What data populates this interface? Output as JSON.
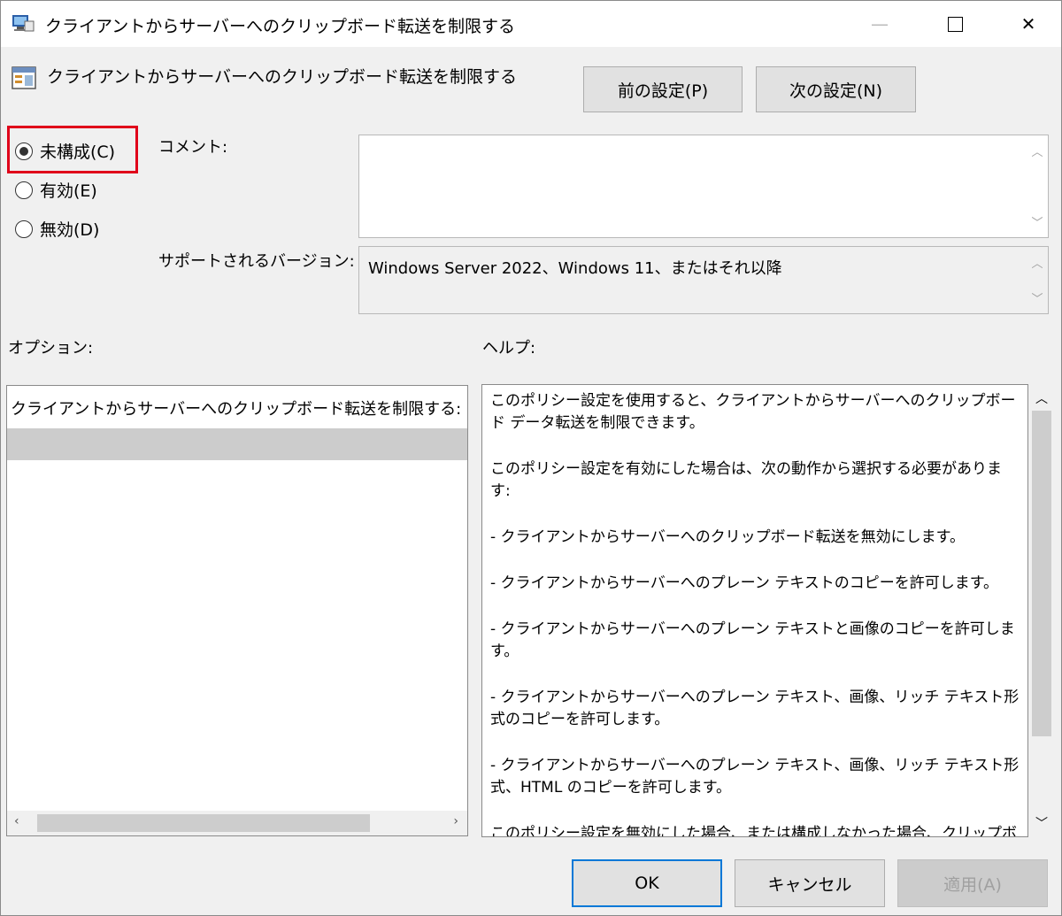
{
  "window": {
    "title": "クライアントからサーバーへのクリップボード転送を制限する",
    "minimize_label": "—",
    "close_label": "✕"
  },
  "heading": {
    "title": "クライアントからサーバーへのクリップボード転送を制限する"
  },
  "nav": {
    "prev_label": "前の設定(P)",
    "next_label": "次の設定(N)"
  },
  "state": {
    "options": [
      {
        "label": "未構成(C)",
        "selected": true
      },
      {
        "label": "有効(E)",
        "selected": false
      },
      {
        "label": "無効(D)",
        "selected": false
      }
    ],
    "highlight_color": "#e0001a"
  },
  "comment": {
    "label": "コメント:",
    "value": ""
  },
  "supported": {
    "label": "サポートされるバージョン:",
    "value": "Windows Server 2022、Windows 11、またはそれ以降"
  },
  "options_panel": {
    "label": "オプション:",
    "title": "クライアントからサーバーへのクリップボード転送を制限する:"
  },
  "help_panel": {
    "label": "ヘルプ:",
    "paragraphs": [
      "このポリシー設定を使用すると、クライアントからサーバーへのクリップボード データ転送を制限できます。",
      "このポリシー設定を有効にした場合は、次の動作から選択する必要があります:",
      "- クライアントからサーバーへのクリップボード転送を無効にします。",
      "- クライアントからサーバーへのプレーン テキストのコピーを許可します。",
      "- クライアントからサーバーへのプレーン テキストと画像のコピーを許可します。",
      "- クライアントからサーバーへのプレーン テキスト、画像、リッチ テキスト形式のコピーを許可します。",
      "- クライアントからサーバーへのプレーン テキスト、画像、リッチ テキスト形式、HTML のコピーを許可します。",
      "このポリシー設定を無効にした場合、または構成しなかった場合、クリップボード リダイレクトが有効になっていれば、ユーザーは任意のコンテンツをクライ"
    ]
  },
  "footer": {
    "ok_label": "OK",
    "cancel_label": "キャンセル",
    "apply_label": "適用(A)"
  }
}
